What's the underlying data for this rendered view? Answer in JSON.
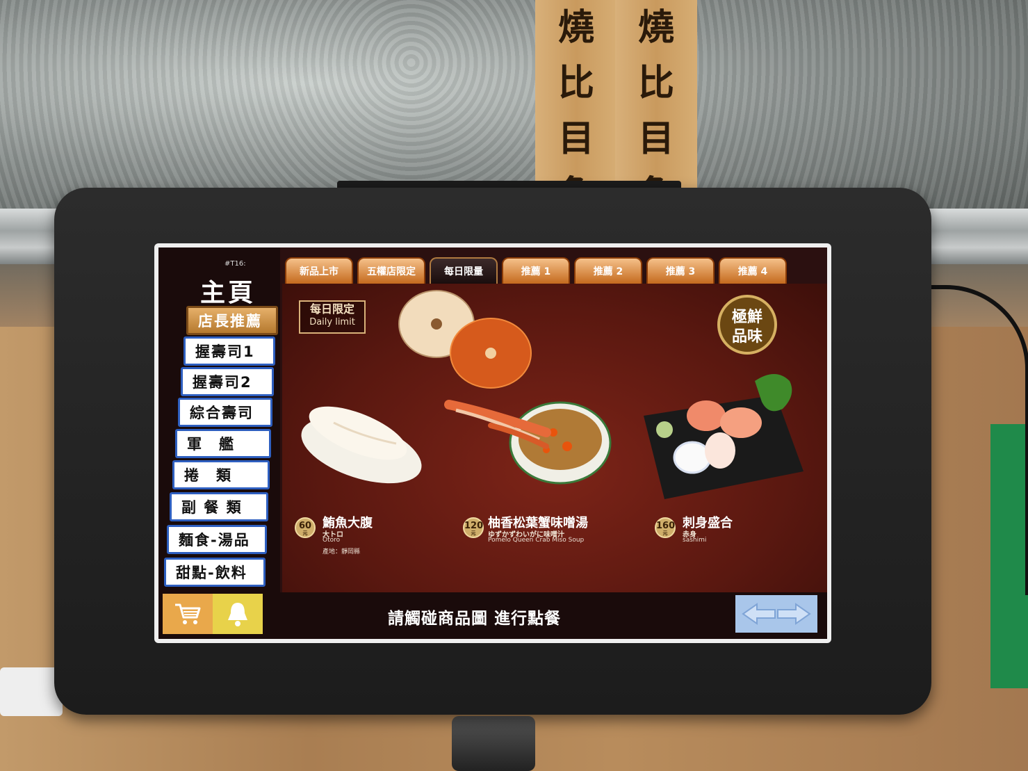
{
  "environment": {
    "sign_left": "燒比目魚",
    "sign_right": "燒比目魚"
  },
  "screen": {
    "table_no": "#T16:",
    "home_title": "主頁",
    "sidebar": {
      "items": [
        {
          "label": "店長推薦",
          "active": true
        },
        {
          "label": "握壽司1",
          "active": false
        },
        {
          "label": "握壽司2",
          "active": false
        },
        {
          "label": "綜合壽司",
          "active": false
        },
        {
          "label": "軍　艦",
          "active": false
        },
        {
          "label": "捲　類",
          "active": false
        },
        {
          "label": "副 餐 類",
          "active": false
        },
        {
          "label": "麵食-湯品",
          "active": false
        },
        {
          "label": "甜點-飲料",
          "active": false
        }
      ],
      "cart_icon": "cart-icon",
      "bell_icon": "bell-icon"
    },
    "tabs": [
      {
        "label": "新品上市",
        "active": false
      },
      {
        "label": "五權店限定",
        "active": false
      },
      {
        "label": "每日限量",
        "active": true
      },
      {
        "label": "推薦 1",
        "active": false
      },
      {
        "label": "推薦 2",
        "active": false
      },
      {
        "label": "推薦 3",
        "active": false
      },
      {
        "label": "推薦 4",
        "active": false
      }
    ],
    "daily_badge": {
      "zh": "每日限定",
      "en": "Daily limit"
    },
    "fresh_badge": "極鮮品味",
    "items": [
      {
        "price": "60",
        "currency": "元",
        "name": "鮪魚大腹",
        "jp": "大トロ",
        "en": "Otoro",
        "origin": "產地：靜岡縣"
      },
      {
        "price": "120",
        "currency": "元",
        "name": "柚香松葉蟹味噌湯",
        "jp": "ゆずかずわいがに味噌汁",
        "en": "Pomelo Queen Crab Miso Soup",
        "origin": ""
      },
      {
        "price": "160",
        "currency": "元",
        "name": "刺身盛合",
        "jp": "赤身",
        "en": "sashimi",
        "origin": ""
      }
    ],
    "hint": "請觸碰商品圖 進行點餐",
    "nav_icon": "left-right-arrows-icon"
  },
  "colors": {
    "tab_orange": "#c46a1e",
    "sidebar_border": "#2e5fc0",
    "active_sidebar": "#b5792e",
    "nav_button": "#a9c6ea",
    "cart_button": "#e9a84b",
    "bell_button": "#e8d24a"
  }
}
